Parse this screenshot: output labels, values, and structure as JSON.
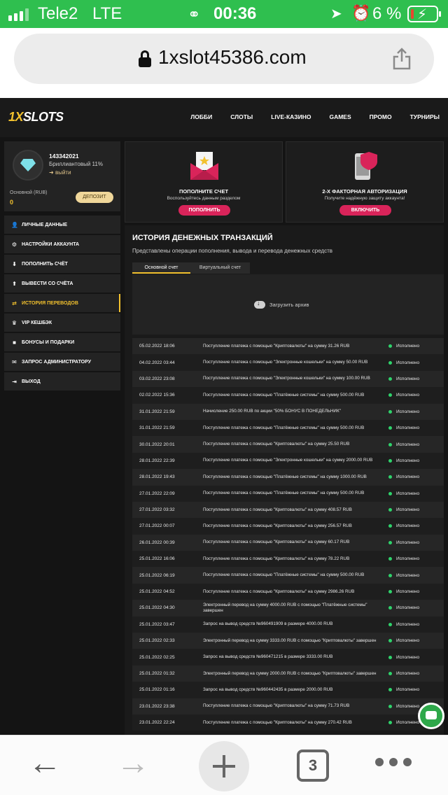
{
  "status_bar": {
    "carrier": "Tele2",
    "network": "LTE",
    "time": "00:36",
    "battery_pct": "6 %"
  },
  "browser": {
    "url": "1xslot45386.com",
    "tabs_count": "3"
  },
  "site": {
    "logo_left": "1X",
    "logo_right": "SLOTS",
    "nav": [
      "ЛОББИ",
      "СЛОТЫ",
      "LIVE-КАЗИНО",
      "GAMES",
      "ПРОМО",
      "ТУРНИРЫ"
    ]
  },
  "profile": {
    "user_id": "143342021",
    "tier": "Бриллиантовый 11%",
    "logout": "выйти",
    "account_label": "Основной (RUB)",
    "balance": "0",
    "deposit_label": "ДЕПОЗИТ"
  },
  "menu": [
    {
      "label": "ЛИЧНЫЕ ДАННЫЕ",
      "icon": "user-plus-icon"
    },
    {
      "label": "НАСТРОЙКИ АККАУНТА",
      "icon": "gears-icon"
    },
    {
      "label": "ПОПОЛНИТЬ СЧЁТ",
      "icon": "download-icon"
    },
    {
      "label": "ВЫВЕСТИ СО СЧЁТА",
      "icon": "upload-icon"
    },
    {
      "label": "ИСТОРИЯ ПЕРЕВОДОВ",
      "icon": "transfer-icon",
      "active": true
    },
    {
      "label": "VIP КЕШБЭК",
      "icon": "crown-icon"
    },
    {
      "label": "БОНУСЫ И ПОДАРКИ",
      "icon": "gift-icon"
    },
    {
      "label": "ЗАПРОС АДМИНИСТРАТОРУ",
      "icon": "envelope-icon"
    },
    {
      "label": "ВЫХОД",
      "icon": "exit-icon"
    }
  ],
  "cards": {
    "topup": {
      "title": "ПОПОЛНИТЕ СЧЕТ",
      "subtitle": "Воспользуйтесь данным разделом",
      "button": "ПОПОЛНИТЬ"
    },
    "twofa": {
      "title": "2-Х ФАКТОРНАЯ АВТОРИЗАЦИЯ",
      "subtitle": "Получите надёжную защиту аккаунта!",
      "button": "ВКЛЮЧИТЬ"
    }
  },
  "history": {
    "title": "ИСТОРИЯ ДЕНЕЖНЫХ ТРАНЗАКЦИЙ",
    "description": "Представлены операции пополнения, вывода и перевода денежных средств",
    "tabs": [
      "Основной счет",
      "Виртуальный счет"
    ],
    "download_label": "Загрузить архив",
    "rows": [
      {
        "date": "05.02.2022 18:06",
        "desc": "Поступление платежа с помощью \"Криптовалюты\" на сумму 31.26 RUB",
        "status": "Исполнено"
      },
      {
        "date": "04.02.2022 03:44",
        "desc": "Поступление платежа с помощью \"Электронные кошельки\" на сумму 50.00 RUB",
        "status": "Исполнено"
      },
      {
        "date": "03.02.2022 23:08",
        "desc": "Поступление платежа с помощью \"Электронные кошельки\" на сумму 100.00 RUB",
        "status": "Исполнено"
      },
      {
        "date": "02.02.2022 15:36",
        "desc": "Поступление платежа с помощью \"Платёжные системы\" на сумму 500.00 RUB",
        "status": "Исполнено"
      },
      {
        "date": "31.01.2022 21:59",
        "desc": "Начисление 250.00 RUB по акции \"50% БОНУС В ПОНЕДЕЛЬНИК\"",
        "status": "Исполнено"
      },
      {
        "date": "31.01.2022 21:59",
        "desc": "Поступление платежа с помощью \"Платёжные системы\" на сумму 500.00 RUB",
        "status": "Исполнено"
      },
      {
        "date": "30.01.2022 20:01",
        "desc": "Поступление платежа с помощью \"Криптовалюты\" на сумму 25.50 RUB",
        "status": "Исполнено"
      },
      {
        "date": "28.01.2022 22:39",
        "desc": "Поступление платежа с помощью \"Электронные кошельки\" на сумму 2000.00 RUB",
        "status": "Исполнено"
      },
      {
        "date": "28.01.2022 19:43",
        "desc": "Поступление платежа с помощью \"Платёжные системы\" на сумму 1000.00 RUB",
        "status": "Исполнено"
      },
      {
        "date": "27.01.2022 22:09",
        "desc": "Поступление платежа с помощью \"Платёжные системы\" на сумму 500.00 RUB",
        "status": "Исполнено"
      },
      {
        "date": "27.01.2022 03:32",
        "desc": "Поступление платежа с помощью \"Криптовалюты\" на сумму 408.57 RUB",
        "status": "Исполнено"
      },
      {
        "date": "27.01.2022 00:07",
        "desc": "Поступление платежа с помощью \"Криптовалюты\" на сумму 256.57 RUB",
        "status": "Исполнено"
      },
      {
        "date": "26.01.2022 00:39",
        "desc": "Поступление платежа с помощью \"Криптовалюты\" на сумму 60.17 RUB",
        "status": "Исполнено"
      },
      {
        "date": "25.01.2022 16:06",
        "desc": "Поступление платежа с помощью \"Криптовалюты\" на сумму 78.22 RUB",
        "status": "Исполнено"
      },
      {
        "date": "25.01.2022 06:19",
        "desc": "Поступление платежа с помощью \"Платёжные системы\" на сумму 500.00 RUB",
        "status": "Исполнено"
      },
      {
        "date": "25.01.2022 04:52",
        "desc": "Поступление платежа с помощью \"Криптовалюты\" на сумму 2986.26 RUB",
        "status": "Исполнено"
      },
      {
        "date": "25.01.2022 04:30",
        "desc": "Электронный перевод на сумму 4000.00 RUB с помощью \"Платёжные системы\" завершен",
        "status": "Исполнено"
      },
      {
        "date": "25.01.2022 03:47",
        "desc": "Запрос на вывод средств №960491909 в размере 4000.00 RUB",
        "status": "Исполнено"
      },
      {
        "date": "25.01.2022 02:33",
        "desc": "Электронный перевод на сумму 3333.00 RUB с помощью \"Криптовалюты\" завершен",
        "status": "Исполнено"
      },
      {
        "date": "25.01.2022 02:25",
        "desc": "Запрос на вывод средств №960471215 в размере 3333.00 RUB",
        "status": "Исполнено"
      },
      {
        "date": "25.01.2022 01:32",
        "desc": "Электронный перевод на сумму 2000.00 RUB с помощью \"Криптовалюты\" завершен",
        "status": "Исполнено"
      },
      {
        "date": "25.01.2022 01:16",
        "desc": "Запрос на вывод средств №960442435 в размере 2000.00 RUB",
        "status": "Исполнено"
      },
      {
        "date": "23.01.2022 23:38",
        "desc": "Поступление платежа с помощью \"Криптовалюты\" на сумму 71.73 RUB",
        "status": "Исполнено"
      },
      {
        "date": "23.01.2022 22:24",
        "desc": "Поступление платежа с помощью \"Криптовалюты\" на сумму 270.42 RUB",
        "status": "Исполнено"
      }
    ]
  },
  "colors": {
    "accent": "#f2c12e",
    "cta": "#d9245a",
    "status_ok": "#2fd36b",
    "ios_status": "#2fbf4f"
  }
}
